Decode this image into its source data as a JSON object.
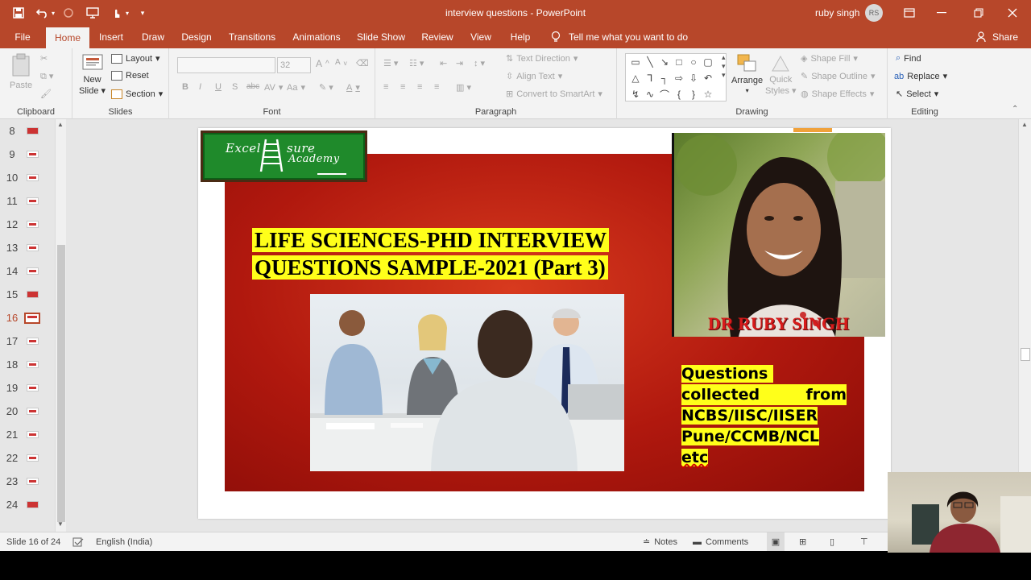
{
  "window": {
    "title": "interview questions  -  PowerPoint",
    "user_name": "ruby singh",
    "user_initials": "RS"
  },
  "quick_access": {
    "icons": [
      "save-icon",
      "undo-icon",
      "redo-icon",
      "present-icon",
      "touch-mode-icon",
      "customize-icon"
    ]
  },
  "tabs": [
    "File",
    "Home",
    "Insert",
    "Draw",
    "Design",
    "Transitions",
    "Animations",
    "Slide Show",
    "Review",
    "View",
    "Help"
  ],
  "active_tab": "Home",
  "tell_me": "Tell me what you want to do",
  "share_label": "Share",
  "ribbon": {
    "clipboard": {
      "label": "Clipboard",
      "paste": "Paste"
    },
    "slides": {
      "label": "Slides",
      "new_slide": "New",
      "new_slide_2": "Slide",
      "layout": "Layout",
      "reset": "Reset",
      "section": "Section"
    },
    "font": {
      "label": "Font",
      "font_size": "32",
      "bold": "B",
      "italic": "I",
      "underline": "U",
      "shadow": "S",
      "strike": "abc",
      "spacing": "AV",
      "case": "Aa",
      "color": "A",
      "grow": "A",
      "shrink": "A"
    },
    "paragraph": {
      "label": "Paragraph",
      "text_direction": "Text Direction",
      "align_text": "Align Text",
      "convert_smartart": "Convert to SmartArt"
    },
    "drawing": {
      "label": "Drawing",
      "arrange": "Arrange",
      "quick_styles": "Quick",
      "quick_styles_2": "Styles",
      "shape_fill": "Shape Fill",
      "shape_outline": "Shape Outline",
      "shape_effects": "Shape Effects"
    },
    "editing": {
      "label": "Editing",
      "find": "Find",
      "replace": "Replace",
      "select": "Select"
    }
  },
  "thumbnails": [
    {
      "num": "8"
    },
    {
      "num": "9"
    },
    {
      "num": "10"
    },
    {
      "num": "11"
    },
    {
      "num": "12"
    },
    {
      "num": "13"
    },
    {
      "num": "14"
    },
    {
      "num": "15"
    },
    {
      "num": "16"
    },
    {
      "num": "17"
    },
    {
      "num": "18"
    },
    {
      "num": "19"
    },
    {
      "num": "20"
    },
    {
      "num": "21"
    },
    {
      "num": "22"
    },
    {
      "num": "23"
    },
    {
      "num": "24"
    }
  ],
  "current_slide_num": "16",
  "slide": {
    "logo_text_1": "Excel",
    "logo_text_2": "sure",
    "logo_text_3": "Academy",
    "title_line_1": "LIFE SCIENCES-PHD INTERVIEW",
    "title_line_2": "QUESTIONS SAMPLE-2021 (Part 3)",
    "presenter": "DR RUBY SINGH",
    "q_line_1": "Questions",
    "q_line_2a": "collected",
    "q_line_2b": "from",
    "q_line_3": "NCBS/IISC/IISER",
    "q_line_4": "Pune/CCMB/NCL",
    "q_line_5": "etc"
  },
  "status_bar": {
    "slide_info": "Slide 16 of 24",
    "language": "English (India)",
    "notes": "Notes",
    "comments": "Comments"
  },
  "colors": {
    "accent": "#b7472a",
    "slide_red": "#b0180e",
    "highlight": "#ffff1a",
    "logo_green": "#1f8a2b"
  }
}
